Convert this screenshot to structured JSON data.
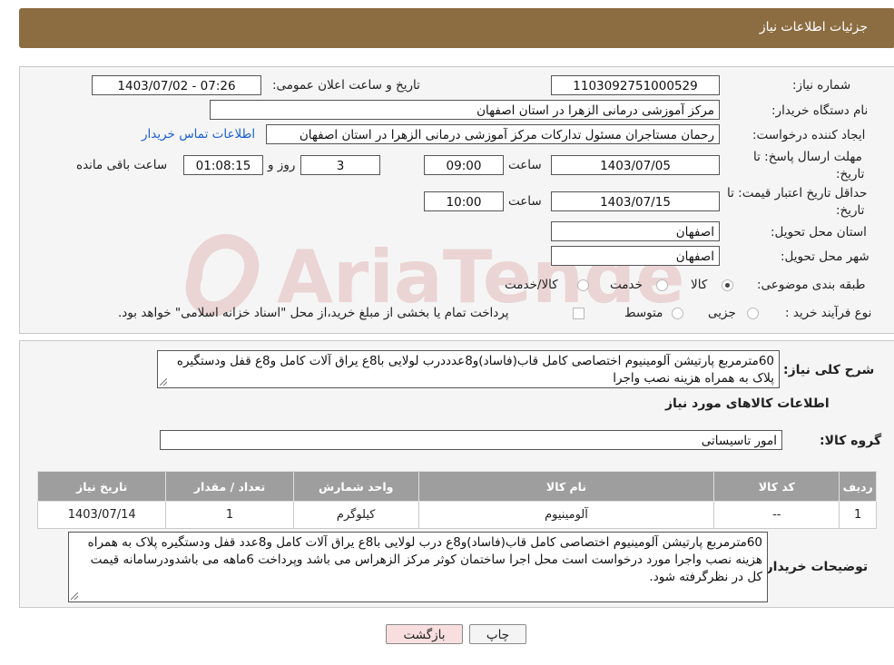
{
  "header": {
    "title": "جزئیات اطلاعات نیاز"
  },
  "form": {
    "need_number_label": "شماره نیاز:",
    "need_number": "1103092751000529",
    "announce_label": "تاریخ و ساعت اعلان عمومی:",
    "announce_value": "1403/07/02 - 07:26",
    "buyer_org_label": "نام دستگاه خریدار:",
    "buyer_org": "مرکز آموزشی درمانی الزهرا در استان اصفهان",
    "creator_label": "ایجاد کننده درخواست:",
    "creator": "رحمان مستاجران مسئول تدارکات مرکز آموزشی درمانی الزهرا در استان اصفهان",
    "contact_link": "اطلاعات تماس خریدار",
    "reply_deadline_label_1": "مهلت ارسال پاسخ: تا",
    "reply_deadline_label_2": "تاریخ:",
    "reply_date": "1403/07/05",
    "time_label": "ساعت",
    "reply_time": "09:00",
    "days_value": "3",
    "days_label": "روز و",
    "remaining_value": "01:08:15",
    "remaining_label": "ساعت باقی مانده",
    "price_validity_label_1": "حداقل تاریخ اعتبار قیمت: تا",
    "price_validity_label_2": "تاریخ:",
    "price_date": "1403/07/15",
    "price_time": "10:00",
    "province_label": "استان محل تحویل:",
    "province": "اصفهان",
    "city_label": "شهر محل تحویل:",
    "city": "اصفهان",
    "category_label": "طبقه بندی موضوعی:",
    "category_options": [
      "کالا",
      "خدمت",
      "کالا/خدمت"
    ],
    "process_label": "نوع فرآیند خرید :",
    "process_options": [
      "جزیی",
      "متوسط"
    ],
    "payment_note": "پرداخت تمام یا بخشی از مبلغ خرید،از محل \"اسناد خزانه اسلامی\" خواهد بود."
  },
  "summary": {
    "label": "شرح کلی نیاز:",
    "text": "60مترمربع پارتیشن آلومینیوم اختصاصی کامل قاب(فاساد)و8عدددرب لولایی با8ع یراق آلات کامل و8ع قفل ودستگیره پلاک به همراه هزینه نصب واجرا"
  },
  "items_section": {
    "title": "اطلاعات کالاهای مورد نیاز",
    "group_label": "گروه کالا:",
    "group_value": "امور تاسیساتی"
  },
  "table": {
    "headers": [
      "ردیف",
      "کد کالا",
      "نام کالا",
      "واحد شمارش",
      "تعداد / مقدار",
      "تاریخ نیاز"
    ],
    "rows": [
      [
        "1",
        "--",
        "آلومینیوم",
        "کیلوگرم",
        "1",
        "1403/07/14"
      ]
    ]
  },
  "buyer_notes": {
    "label": "توضیحات خریدار:",
    "text": "60مترمربع پارتیشن آلومینیوم اختصاصی کامل قاب(فاساد)و8ع درب لولایی با8ع یراق آلات کامل و8عدد قفل ودستگیره پلاک به همراه هزینه نصب واجرا مورد درخواست است محل اجرا ساختمان کوثر مرکز الزهراس می باشد وپرداخت 6ماهه می باشدودرسامانه قیمت کل در نظرگرفته شود."
  },
  "buttons": {
    "print": "چاپ",
    "back": "بازگشت"
  },
  "watermark": {
    "text": "AriaTender.neT"
  },
  "colors": {
    "header": "#8c6d42",
    "table_header": "#9e9e9e",
    "link": "#1a5fd0",
    "back_button": "#f8dede"
  }
}
